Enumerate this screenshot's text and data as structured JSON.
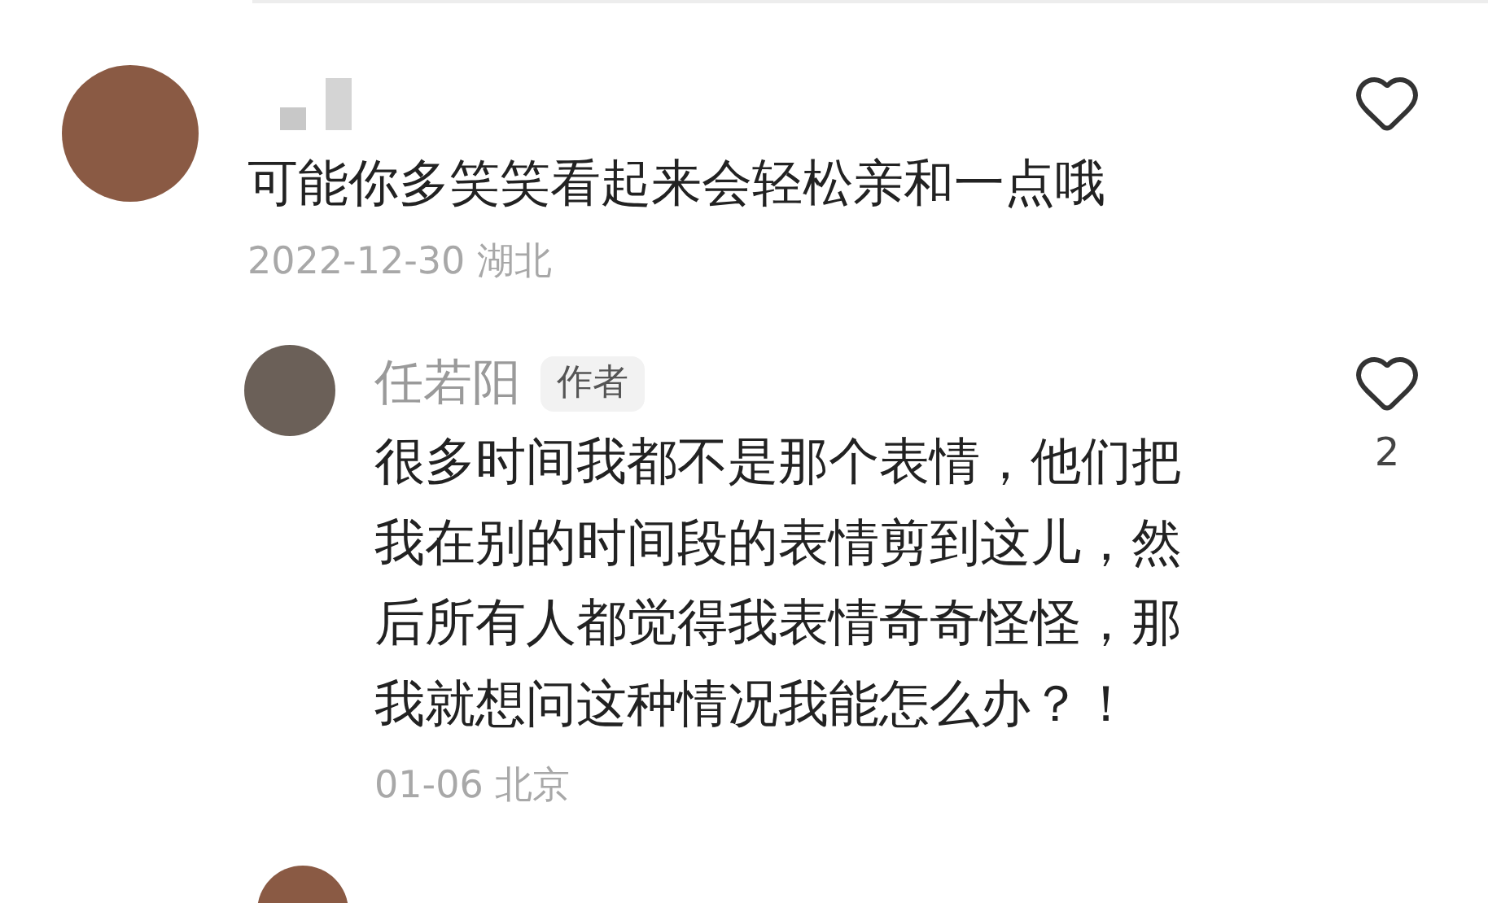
{
  "comments": [
    {
      "author_name_blurred": true,
      "text": "可能你多笑笑看起来会轻松亲和一点哦",
      "meta": "2022-12-30 湖北",
      "replies": [
        {
          "author": "任若阳",
          "badge": "作者",
          "text": "很多时间我都不是那个表情，他们把我在别的时间段的表情剪到这儿，然后所有人都觉得我表情奇奇怪怪，那我就想问这种情况我能怎么办？！",
          "meta": "01-06 北京",
          "likes": "2"
        }
      ]
    }
  ]
}
